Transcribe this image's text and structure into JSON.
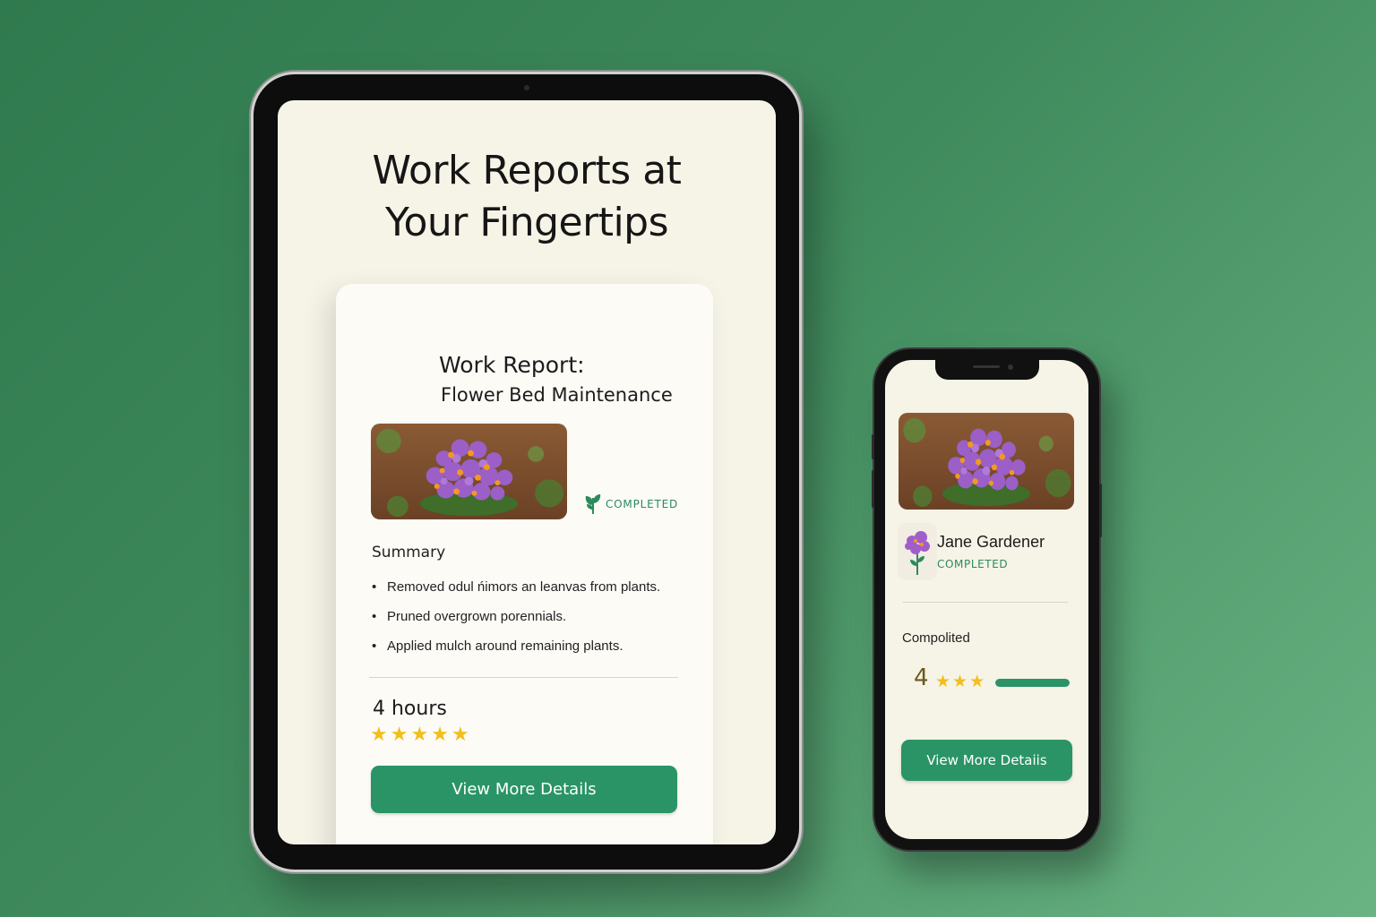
{
  "tablet": {
    "hero_title": "Work Reports at\nYour Fingertips",
    "card": {
      "title": "Work Report:",
      "subtitle": "Flower Bed Maintenance",
      "status": "COMPLETED",
      "summary_label": "Summary",
      "summary_items": [
        "Removed odul ńimors an leanvas from plants.",
        "Pruned overgrown porennials.",
        "Applied mulch around remaining plants."
      ],
      "duration": "4 hours",
      "rating_stars": 5,
      "button_label": "View More Details"
    }
  },
  "phone": {
    "name": "Jane Gardener",
    "status": "COMPLETED",
    "section_label": "Compolited",
    "rating_value": "4",
    "rating_stars": 3,
    "progress_fraction": 1.0,
    "button_label": "View More Detaiis"
  },
  "colors": {
    "background_start": "#2f7a4e",
    "background_end": "#6ab383",
    "accent_green": "#2a9466",
    "star_yellow": "#f2bf1b",
    "screen_cream": "#f6f3e7"
  },
  "icons": {
    "status_icon": "sprout-icon",
    "star_icon": "star-icon",
    "avatar_icon": "flower-avatar-icon"
  }
}
